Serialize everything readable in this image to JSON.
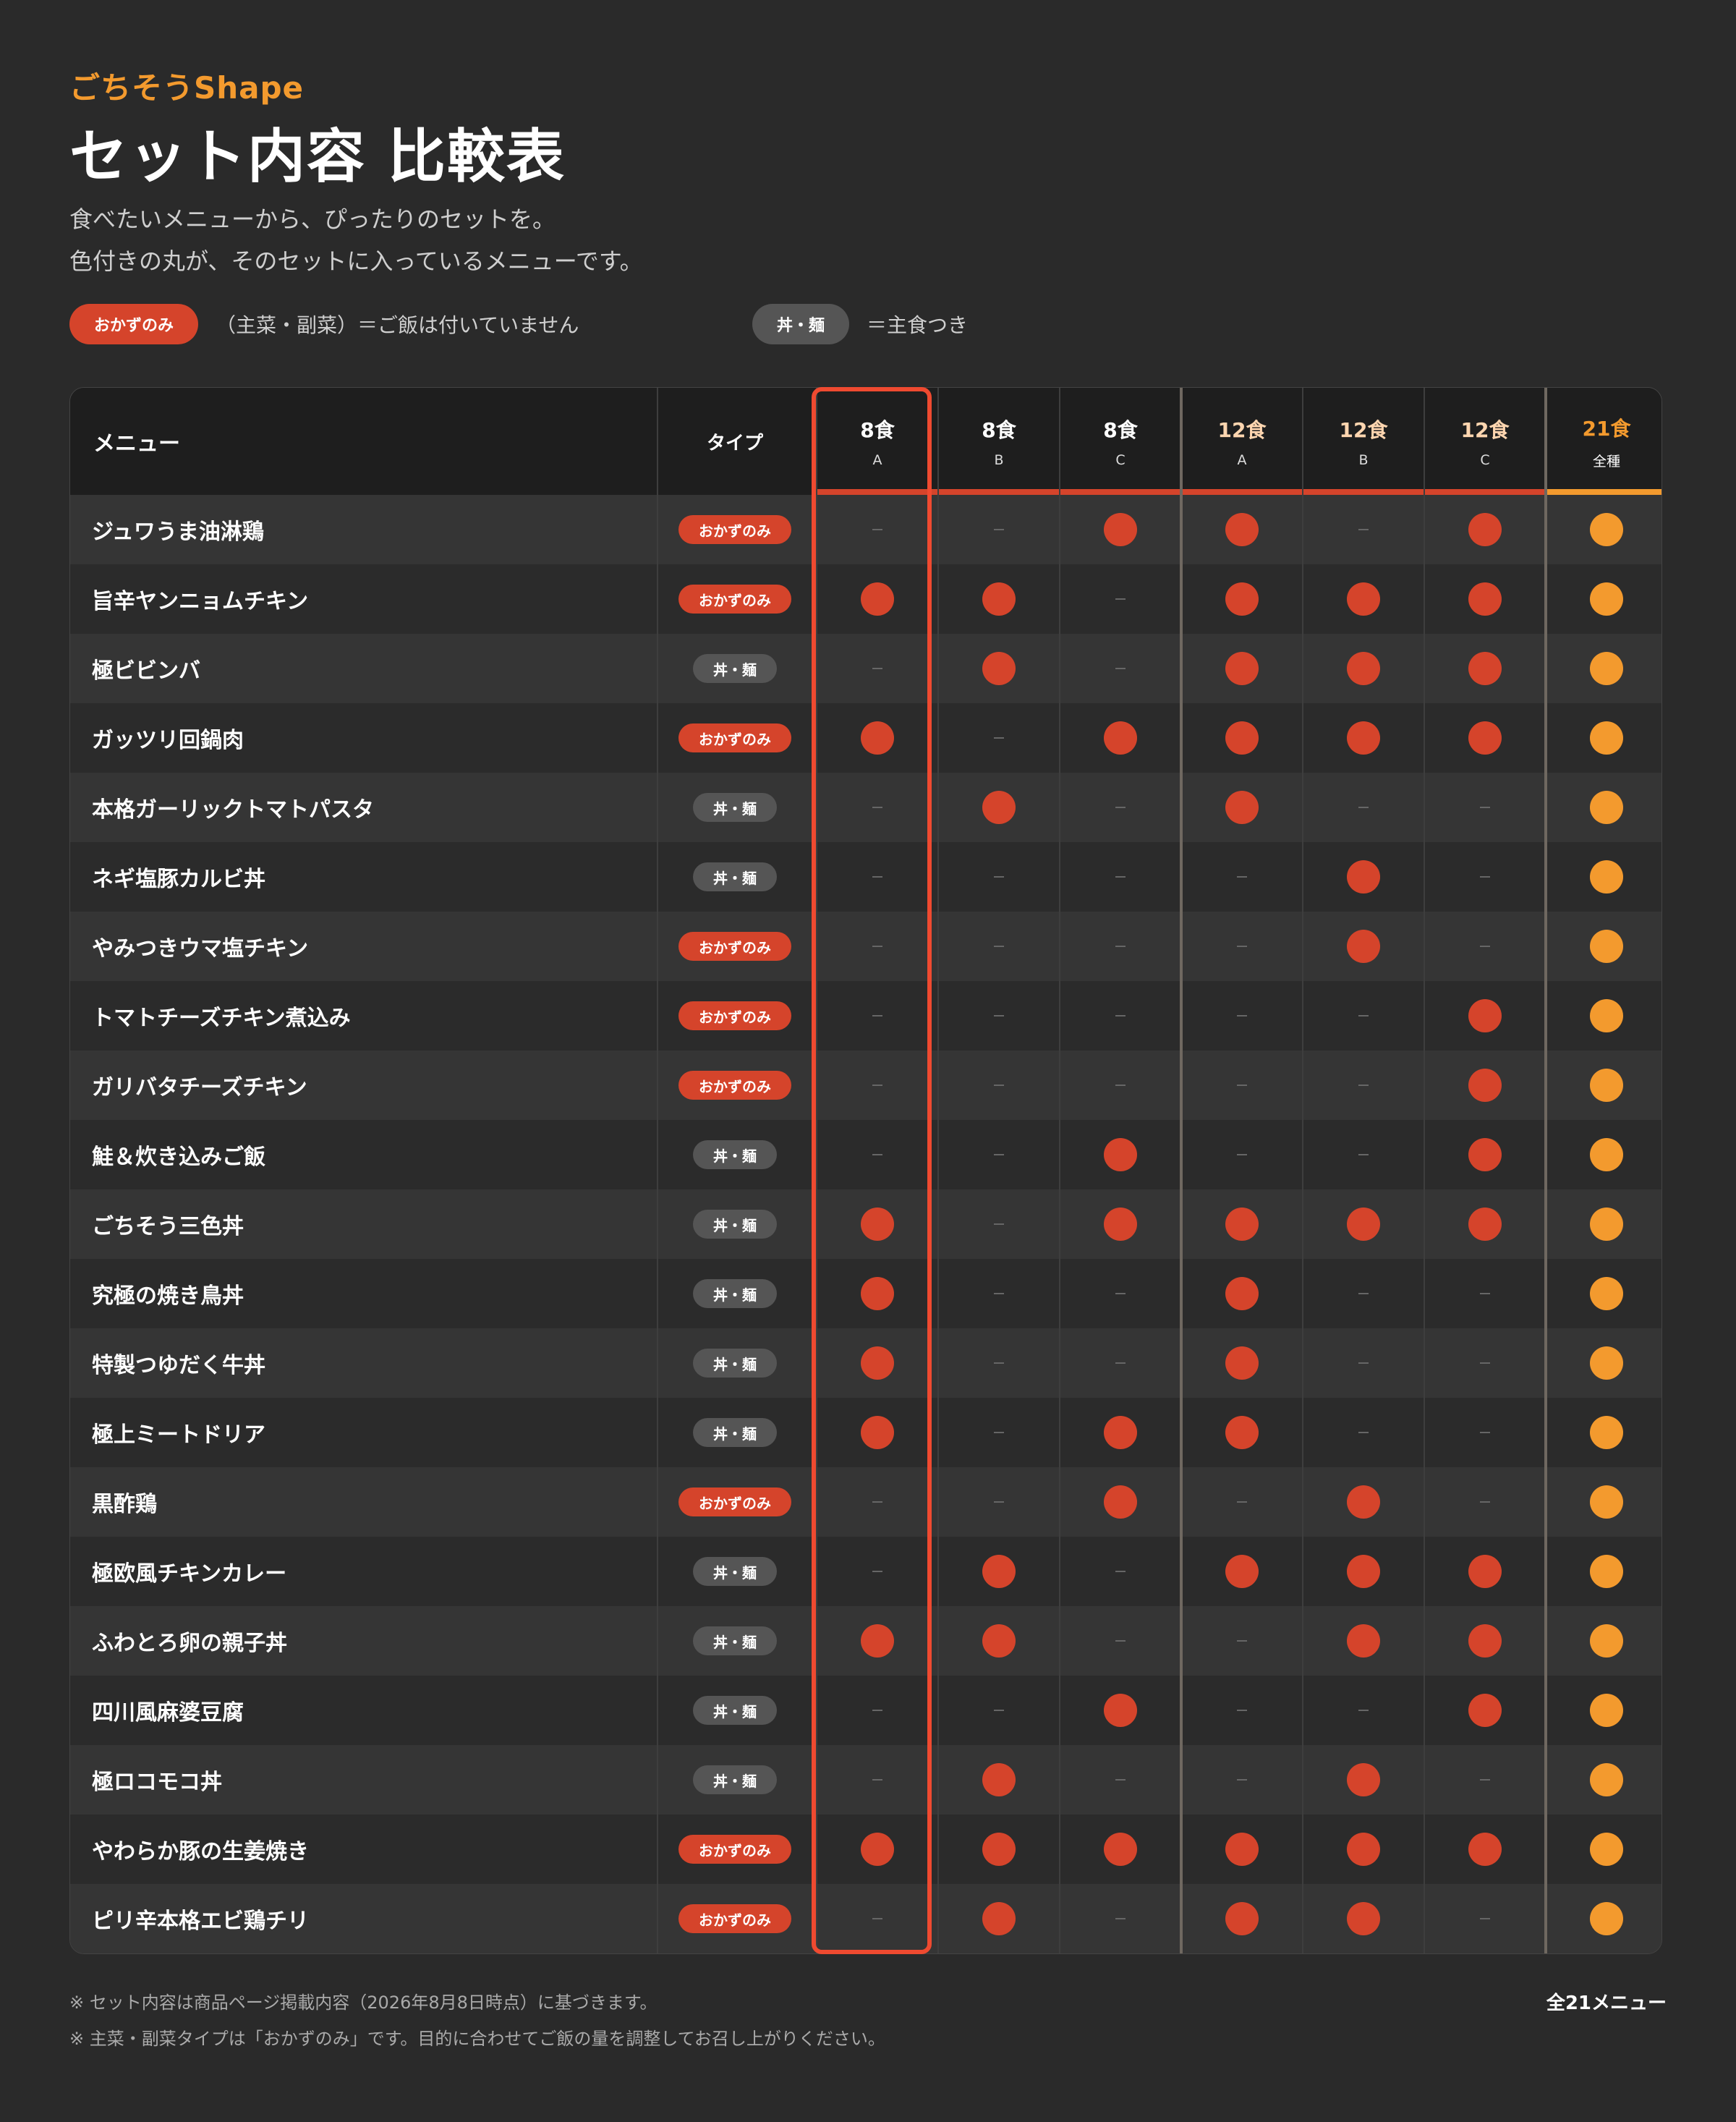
{
  "brand": "ごちそうShape",
  "title": "セット内容 比較表",
  "subtitle_lines": [
    "食べたいメニューから、ぴったりのセットを。",
    "色付きの丸が、そのセットに入っているメニューです。"
  ],
  "legend": {
    "okazu_label": "おかずのみ",
    "okazu_desc": "（主菜・副菜）＝ご飯は付いていません",
    "don_label": "丼・麺",
    "don_desc": "＝主食つき"
  },
  "table": {
    "menu_header": "メニュー",
    "type_header": "タイプ",
    "columns": [
      {
        "top": "8食",
        "sub": "A"
      },
      {
        "top": "8食",
        "sub": "B"
      },
      {
        "top": "8食",
        "sub": "C"
      },
      {
        "top": "12食",
        "sub": "A"
      },
      {
        "top": "12食",
        "sub": "B"
      },
      {
        "top": "12食",
        "sub": "C"
      },
      {
        "top": "21食",
        "sub": "全種"
      }
    ],
    "type_labels": {
      "okazu": "おかずのみ",
      "don": "丼・麺"
    },
    "rows": [
      {
        "name": "ジュワうま油淋鶏",
        "type": "okazu",
        "sets": [
          0,
          0,
          1,
          1,
          0,
          1,
          1
        ]
      },
      {
        "name": "旨辛ヤンニョムチキン",
        "type": "okazu",
        "sets": [
          1,
          1,
          0,
          1,
          1,
          1,
          1
        ]
      },
      {
        "name": "極ビビンバ",
        "type": "don",
        "sets": [
          0,
          1,
          0,
          1,
          1,
          1,
          1
        ]
      },
      {
        "name": "ガッツリ回鍋肉",
        "type": "okazu",
        "sets": [
          1,
          0,
          1,
          1,
          1,
          1,
          1
        ]
      },
      {
        "name": "本格ガーリックトマトパスタ",
        "type": "don",
        "sets": [
          0,
          1,
          0,
          1,
          0,
          0,
          1
        ]
      },
      {
        "name": "ネギ塩豚カルビ丼",
        "type": "don",
        "sets": [
          0,
          0,
          0,
          0,
          1,
          0,
          1
        ]
      },
      {
        "name": "やみつきウマ塩チキン",
        "type": "okazu",
        "sets": [
          0,
          0,
          0,
          0,
          1,
          0,
          1
        ]
      },
      {
        "name": "トマトチーズチキン煮込み",
        "type": "okazu",
        "sets": [
          0,
          0,
          0,
          0,
          0,
          1,
          1
        ]
      },
      {
        "name": "ガリバタチーズチキン",
        "type": "okazu",
        "sets": [
          0,
          0,
          0,
          0,
          0,
          1,
          1
        ]
      },
      {
        "name": "鮭＆炊き込みご飯",
        "type": "don",
        "sets": [
          0,
          0,
          1,
          0,
          0,
          1,
          1
        ]
      },
      {
        "name": "ごちそう三色丼",
        "type": "don",
        "sets": [
          1,
          0,
          1,
          1,
          1,
          1,
          1
        ]
      },
      {
        "name": "究極の焼き鳥丼",
        "type": "don",
        "sets": [
          1,
          0,
          0,
          1,
          0,
          0,
          1
        ]
      },
      {
        "name": "特製つゆだく牛丼",
        "type": "don",
        "sets": [
          1,
          0,
          0,
          1,
          0,
          0,
          1
        ]
      },
      {
        "name": "極上ミートドリア",
        "type": "don",
        "sets": [
          1,
          0,
          1,
          1,
          0,
          0,
          1
        ]
      },
      {
        "name": "黒酢鶏",
        "type": "okazu",
        "sets": [
          0,
          0,
          1,
          0,
          1,
          0,
          1
        ]
      },
      {
        "name": "極欧風チキンカレー",
        "type": "don",
        "sets": [
          0,
          1,
          0,
          1,
          1,
          1,
          1
        ]
      },
      {
        "name": "ふわとろ卵の親子丼",
        "type": "don",
        "sets": [
          1,
          1,
          0,
          0,
          1,
          1,
          1
        ]
      },
      {
        "name": "四川風麻婆豆腐",
        "type": "don",
        "sets": [
          0,
          0,
          1,
          0,
          0,
          1,
          1
        ]
      },
      {
        "name": "極ロコモコ丼",
        "type": "don",
        "sets": [
          0,
          1,
          0,
          0,
          1,
          0,
          1
        ]
      },
      {
        "name": "やわらか豚の生姜焼き",
        "type": "okazu",
        "sets": [
          1,
          1,
          1,
          1,
          1,
          1,
          1
        ]
      },
      {
        "name": "ピリ辛本格エビ鶏チリ",
        "type": "okazu",
        "sets": [
          0,
          1,
          0,
          1,
          1,
          0,
          1
        ]
      }
    ]
  },
  "notes": [
    "※ セット内容は商品ページ掲載内容（2026年8月8日時点）に基づきます。",
    "※ 主菜・副菜タイプは「おかずのみ」です。目的に合わせてご飯の量を調整してお召し上がりください。"
  ],
  "total": "全21メニュー",
  "colors": {
    "okazu": "#d5442b",
    "don": "#555555",
    "dot": "#d5442b",
    "full_dot": "#f39a2e",
    "highlight": "#ef4a30"
  }
}
